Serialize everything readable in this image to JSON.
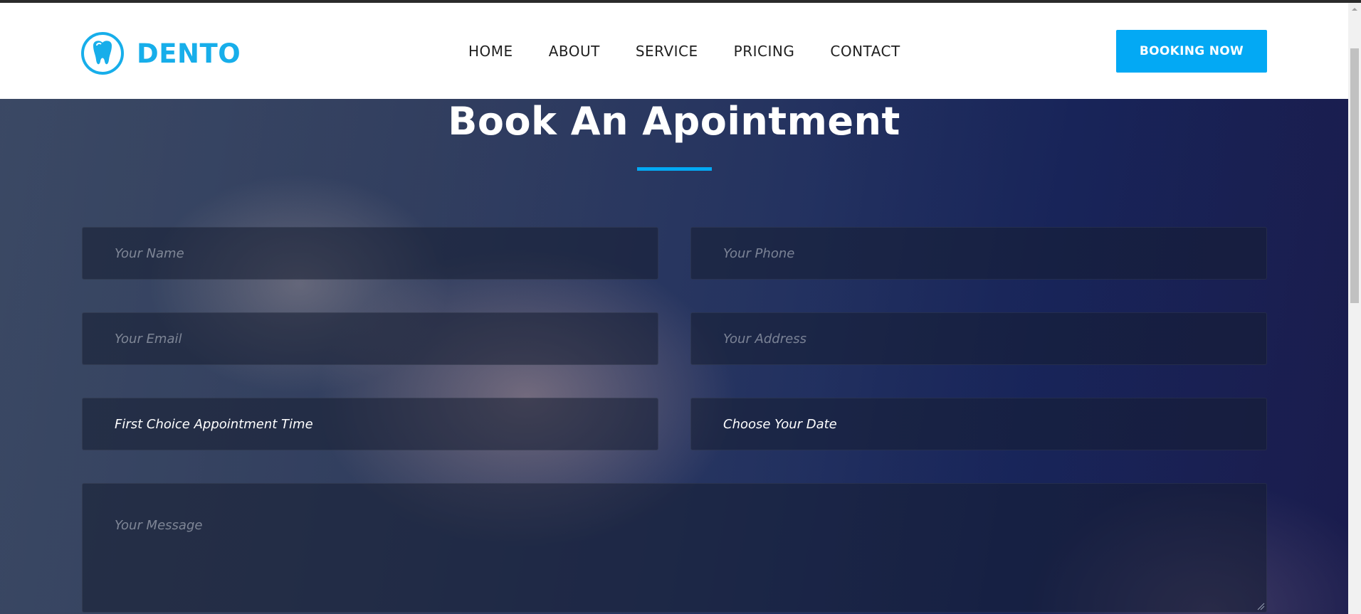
{
  "brand": {
    "name": "DENTO",
    "accent_color": "#03a9f4",
    "logo_icon": "tooth-icon"
  },
  "nav": {
    "items": [
      {
        "label": "HOME"
      },
      {
        "label": "ABOUT"
      },
      {
        "label": "SERVICE"
      },
      {
        "label": "PRICING"
      },
      {
        "label": "CONTACT"
      }
    ],
    "cta_label": "BOOKING NOW"
  },
  "booking": {
    "title": "Book An Apointment",
    "fields": {
      "name_placeholder": "Your Name",
      "phone_placeholder": "Your Phone",
      "email_placeholder": "Your Email",
      "address_placeholder": "Your Address",
      "time_value": "First Choice Appointment Time",
      "date_value": "Choose Your Date",
      "message_placeholder": "Your Message"
    }
  }
}
